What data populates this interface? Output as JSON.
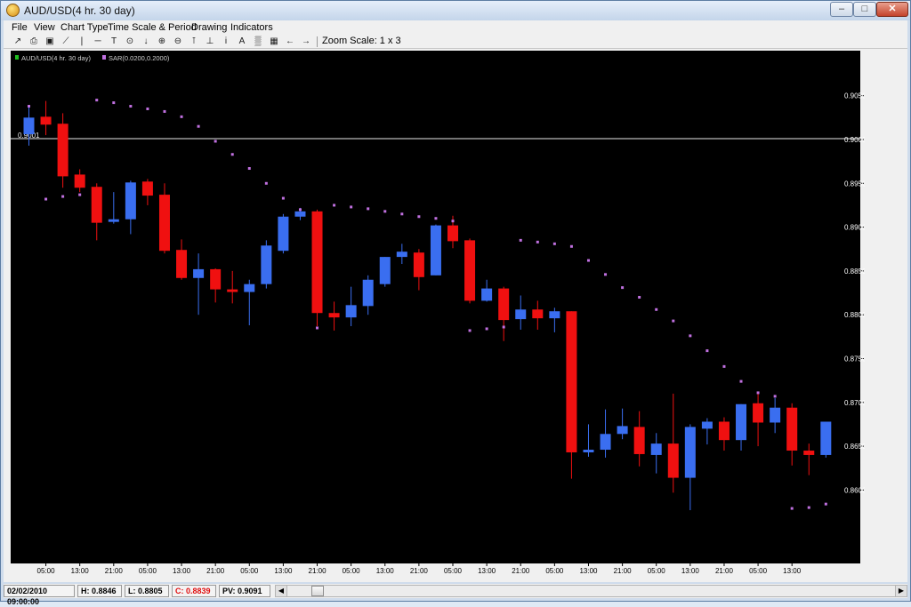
{
  "window": {
    "title": "AUD/USD(4 hr.  30 day)"
  },
  "menu": [
    "File",
    "View",
    "Chart Type",
    "Time Scale & Period",
    "Drawing",
    "Indicators"
  ],
  "toolbar": {
    "icons": [
      "line-chart-icon",
      "print-icon",
      "save-icon",
      "trend-line-icon",
      "vertical-line-icon",
      "horizontal-line-icon",
      "text-tool-icon",
      "crosshair-icon",
      "arrow-down-icon",
      "zoom-in-icon",
      "zoom-out-icon",
      "fibonacci-icon",
      "anchor-icon",
      "info-icon",
      "annotate-icon",
      "indicator-icon",
      "properties-icon",
      "scroll-left-icon",
      "scroll-right-icon"
    ],
    "zoom_label": "Zoom Scale: 1 x 3"
  },
  "legend": [
    {
      "label": "AUD/USD(4 hr.  30 day)",
      "color": "#20c020"
    },
    {
      "label": "SAR(0.0200,0.2000)",
      "color": "#c070e0"
    }
  ],
  "status": {
    "datetime": "02/02/2010 09:00:00",
    "high": "H: 0.8846",
    "low": "L: 0.8805",
    "close": "C: 0.8839",
    "pv": "PV: 0.9091"
  },
  "chart_data": {
    "type": "candlestick",
    "title": "AUD/USD(4 hr.  30 day)",
    "ylim": [
      0.857,
      0.9105
    ],
    "yticks": [
      0.905,
      0.9,
      0.895,
      0.89,
      0.885,
      0.88,
      0.875,
      0.87,
      0.865,
      0.86
    ],
    "ytick_labels": [
      "0.9050",
      "0.9000",
      "0.8950",
      "0.8900",
      "0.8850",
      "0.8800",
      "0.8750",
      "0.8700",
      "0.8650",
      "0.8600"
    ],
    "xtick_labels": [
      "05:00",
      "13:00",
      "21:00",
      "05:00",
      "13:00",
      "21:00",
      "05:00",
      "13:00",
      "21:00",
      "05:00",
      "13:00",
      "21:00",
      "05:00",
      "13:00",
      "21:00",
      "05:00",
      "13:00",
      "21:00",
      "05:00",
      "13:00",
      "21:00",
      "05:00",
      "13:00"
    ],
    "xtick_index": [
      1,
      3,
      5,
      7,
      9,
      11,
      13,
      15,
      17,
      19,
      21,
      23,
      25,
      27,
      29,
      31,
      33,
      35,
      37,
      39,
      41,
      43,
      45
    ],
    "current_price": 0.9001,
    "current_price_label": "0.9001",
    "up_color": "#3a6ef0",
    "down_color": "#f01010",
    "sar_color": "#c070e0",
    "candles": [
      {
        "o": 0.9006,
        "h": 0.9038,
        "l": 0.8993,
        "c": 0.9025
      },
      {
        "o": 0.9026,
        "h": 0.9044,
        "l": 0.9005,
        "c": 0.9017
      },
      {
        "o": 0.9018,
        "h": 0.903,
        "l": 0.8945,
        "c": 0.8958
      },
      {
        "o": 0.896,
        "h": 0.8966,
        "l": 0.894,
        "c": 0.8945
      },
      {
        "o": 0.8946,
        "h": 0.895,
        "l": 0.8885,
        "c": 0.8905
      },
      {
        "o": 0.8906,
        "h": 0.894,
        "l": 0.8904,
        "c": 0.8909
      },
      {
        "o": 0.8909,
        "h": 0.8953,
        "l": 0.8892,
        "c": 0.8951
      },
      {
        "o": 0.8952,
        "h": 0.8955,
        "l": 0.8925,
        "c": 0.8936
      },
      {
        "o": 0.8937,
        "h": 0.895,
        "l": 0.887,
        "c": 0.8873
      },
      {
        "o": 0.8874,
        "h": 0.8886,
        "l": 0.884,
        "c": 0.8842
      },
      {
        "o": 0.8842,
        "h": 0.887,
        "l": 0.88,
        "c": 0.8852
      },
      {
        "o": 0.8852,
        "h": 0.8853,
        "l": 0.8814,
        "c": 0.8829
      },
      {
        "o": 0.8829,
        "h": 0.885,
        "l": 0.8813,
        "c": 0.8826
      },
      {
        "o": 0.8826,
        "h": 0.884,
        "l": 0.8788,
        "c": 0.8835
      },
      {
        "o": 0.8835,
        "h": 0.8885,
        "l": 0.883,
        "c": 0.8879
      },
      {
        "o": 0.8873,
        "h": 0.8915,
        "l": 0.887,
        "c": 0.8912
      },
      {
        "o": 0.8912,
        "h": 0.8922,
        "l": 0.8908,
        "c": 0.8918
      },
      {
        "o": 0.8918,
        "h": 0.892,
        "l": 0.8787,
        "c": 0.8802
      },
      {
        "o": 0.8802,
        "h": 0.8815,
        "l": 0.8782,
        "c": 0.8797
      },
      {
        "o": 0.8797,
        "h": 0.8832,
        "l": 0.8787,
        "c": 0.8811
      },
      {
        "o": 0.881,
        "h": 0.8845,
        "l": 0.88,
        "c": 0.884
      },
      {
        "o": 0.8835,
        "h": 0.8866,
        "l": 0.8832,
        "c": 0.8866
      },
      {
        "o": 0.8866,
        "h": 0.8881,
        "l": 0.8858,
        "c": 0.8872
      },
      {
        "o": 0.8871,
        "h": 0.8875,
        "l": 0.8828,
        "c": 0.8843
      },
      {
        "o": 0.8845,
        "h": 0.8903,
        "l": 0.8845,
        "c": 0.8902
      },
      {
        "o": 0.8902,
        "h": 0.8913,
        "l": 0.8876,
        "c": 0.8884
      },
      {
        "o": 0.8885,
        "h": 0.8887,
        "l": 0.8813,
        "c": 0.8816
      },
      {
        "o": 0.8816,
        "h": 0.884,
        "l": 0.8815,
        "c": 0.883
      },
      {
        "o": 0.883,
        "h": 0.8832,
        "l": 0.877,
        "c": 0.8794
      },
      {
        "o": 0.8795,
        "h": 0.8822,
        "l": 0.8783,
        "c": 0.8806
      },
      {
        "o": 0.8806,
        "h": 0.8816,
        "l": 0.8783,
        "c": 0.8796
      },
      {
        "o": 0.8796,
        "h": 0.8808,
        "l": 0.878,
        "c": 0.8804
      },
      {
        "o": 0.8804,
        "h": 0.8804,
        "l": 0.8613,
        "c": 0.8643
      },
      {
        "o": 0.8643,
        "h": 0.8675,
        "l": 0.8638,
        "c": 0.8646
      },
      {
        "o": 0.8646,
        "h": 0.8692,
        "l": 0.8637,
        "c": 0.8664
      },
      {
        "o": 0.8664,
        "h": 0.8693,
        "l": 0.8658,
        "c": 0.8673
      },
      {
        "o": 0.8672,
        "h": 0.869,
        "l": 0.8627,
        "c": 0.8641
      },
      {
        "o": 0.864,
        "h": 0.8665,
        "l": 0.8619,
        "c": 0.8653
      },
      {
        "o": 0.8653,
        "h": 0.871,
        "l": 0.8597,
        "c": 0.8614
      },
      {
        "o": 0.8614,
        "h": 0.8675,
        "l": 0.8577,
        "c": 0.8672
      },
      {
        "o": 0.867,
        "h": 0.8682,
        "l": 0.8652,
        "c": 0.8678
      },
      {
        "o": 0.8678,
        "h": 0.8683,
        "l": 0.8645,
        "c": 0.8657
      },
      {
        "o": 0.8657,
        "h": 0.8698,
        "l": 0.8645,
        "c": 0.8698
      },
      {
        "o": 0.8699,
        "h": 0.871,
        "l": 0.865,
        "c": 0.8677
      },
      {
        "o": 0.8677,
        "h": 0.8705,
        "l": 0.8665,
        "c": 0.8694
      },
      {
        "o": 0.8694,
        "h": 0.8699,
        "l": 0.8628,
        "c": 0.8645
      },
      {
        "o": 0.8645,
        "h": 0.8653,
        "l": 0.8617,
        "c": 0.864
      },
      {
        "o": 0.864,
        "h": 0.8678,
        "l": 0.8637,
        "c": 0.8678
      }
    ],
    "sar": [
      [
        0,
        0.9038
      ],
      [
        1,
        0.8932
      ],
      [
        2,
        0.8935
      ],
      [
        3,
        0.8937
      ],
      [
        4,
        0.9045
      ],
      [
        5,
        0.9042
      ],
      [
        6,
        0.9038
      ],
      [
        7,
        0.9035
      ],
      [
        8,
        0.9032
      ],
      [
        9,
        0.9026
      ],
      [
        10,
        0.9015
      ],
      [
        11,
        0.8998
      ],
      [
        12,
        0.8983
      ],
      [
        13,
        0.8967
      ],
      [
        14,
        0.895
      ],
      [
        15,
        0.8933
      ],
      [
        16,
        0.892
      ],
      [
        17,
        0.8785
      ],
      [
        18,
        0.8925
      ],
      [
        19,
        0.8923
      ],
      [
        20,
        0.8921
      ],
      [
        21,
        0.8918
      ],
      [
        22,
        0.8915
      ],
      [
        23,
        0.8912
      ],
      [
        24,
        0.891
      ],
      [
        25,
        0.8907
      ],
      [
        26,
        0.8782
      ],
      [
        27,
        0.8784
      ],
      [
        28,
        0.8786
      ],
      [
        29,
        0.8885
      ],
      [
        30,
        0.8883
      ],
      [
        31,
        0.8881
      ],
      [
        32,
        0.8878
      ],
      [
        33,
        0.8862
      ],
      [
        34,
        0.8846
      ],
      [
        35,
        0.8831
      ],
      [
        36,
        0.882
      ],
      [
        37,
        0.8806
      ],
      [
        38,
        0.8793
      ],
      [
        39,
        0.8776
      ],
      [
        40,
        0.8759
      ],
      [
        41,
        0.8741
      ],
      [
        42,
        0.8724
      ],
      [
        43,
        0.8711
      ],
      [
        44,
        0.8707
      ],
      [
        45,
        0.8579
      ],
      [
        46,
        0.858
      ],
      [
        47,
        0.8584
      ]
    ]
  }
}
